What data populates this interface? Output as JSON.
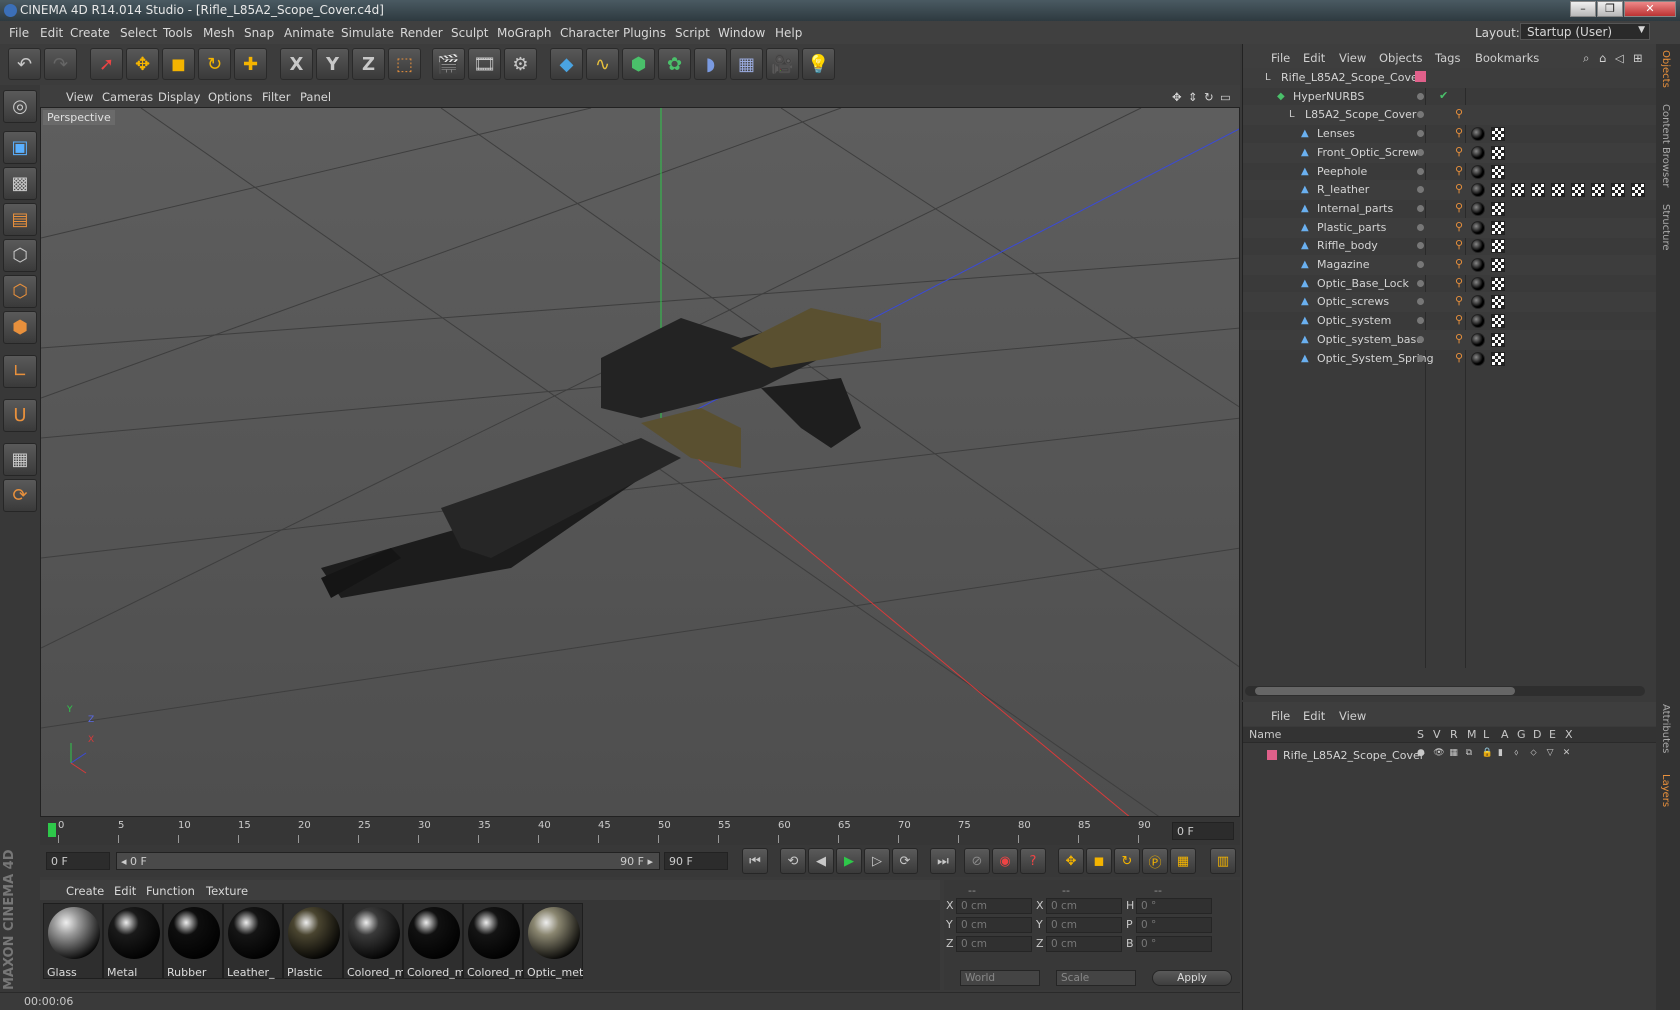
{
  "window": {
    "title": "CINEMA 4D R14.014 Studio - [Rifle_L85A2_Scope_Cover.c4d]",
    "controls": [
      "–",
      "❐",
      "✕"
    ]
  },
  "menu": [
    "File",
    "Edit",
    "Create",
    "Select",
    "Tools",
    "Mesh",
    "Snap",
    "Animate",
    "Simulate",
    "Render",
    "Sculpt",
    "MoGraph",
    "Character",
    "Plugins",
    "Script",
    "Window",
    "Help"
  ],
  "layout": {
    "label": "Layout:",
    "value": "Startup (User)"
  },
  "toolbar_icons": [
    "undo-icon",
    "redo-icon",
    "select-icon",
    "move-icon",
    "scale-icon",
    "rotate-icon",
    "live-select-icon",
    "x-axis-icon",
    "y-axis-icon",
    "z-axis-icon",
    "coordinate-system-icon",
    "render-view-icon",
    "render-picture-viewer-icon",
    "render-settings-icon",
    "cube-icon",
    "spline-icon",
    "nurbs-icon",
    "array-icon",
    "deformer-icon",
    "floor-icon",
    "camera-icon",
    "light-icon"
  ],
  "toolbar_glyphs": {
    "x": "X",
    "y": "Y",
    "z": "Z"
  },
  "viewport": {
    "menu": [
      "View",
      "Cameras",
      "Display",
      "Options",
      "Filter",
      "Panel"
    ],
    "label": "Perspective",
    "axis_labels": {
      "y": "Y",
      "z": "Z",
      "x": "X"
    }
  },
  "timeline": {
    "ticks": [
      "0",
      "5",
      "10",
      "15",
      "20",
      "25",
      "30",
      "35",
      "40",
      "45",
      "50",
      "55",
      "60",
      "65",
      "70",
      "75",
      "80",
      "85",
      "90"
    ],
    "current": "0 F"
  },
  "transport": {
    "start": "0 F",
    "range_start": "◂ 0 F",
    "range_end": "90 F ▸",
    "end": "90 F"
  },
  "materials": {
    "menu": [
      "Create",
      "Edit",
      "Function",
      "Texture"
    ],
    "items": [
      {
        "name": "Glass",
        "color": "#9a9a9a"
      },
      {
        "name": "Metal",
        "color": "#1a1a1a"
      },
      {
        "name": "Rubber",
        "color": "#0e0e0e"
      },
      {
        "name": "Leather_",
        "color": "#151515"
      },
      {
        "name": "Plastic",
        "color": "#4a4530"
      },
      {
        "name": "Colored_m",
        "color": "#3a3a3a"
      },
      {
        "name": "Colored_m",
        "color": "#111111"
      },
      {
        "name": "Colored_m",
        "color": "#141414"
      },
      {
        "name": "Optic_meta",
        "color": "#8a8670"
      }
    ],
    "brand": "MAXON CINEMA 4D"
  },
  "coords": {
    "headers": [
      "--",
      "--",
      "--"
    ],
    "rows": [
      {
        "a": "X",
        "av": "0 cm",
        "b": "X",
        "bv": "0 cm",
        "c": "H",
        "cv": "0 °"
      },
      {
        "a": "Y",
        "av": "0 cm",
        "b": "Y",
        "bv": "0 cm",
        "c": "P",
        "cv": "0 °"
      },
      {
        "a": "Z",
        "av": "0 cm",
        "b": "Z",
        "bv": "0 cm",
        "c": "B",
        "cv": "0 °"
      }
    ],
    "world": "World",
    "scale": "Scale",
    "apply": "Apply"
  },
  "status": "00:00:06",
  "objects": {
    "menu": [
      "File",
      "Edit",
      "View",
      "Objects",
      "Tags",
      "Bookmarks"
    ],
    "tree": [
      {
        "name": "Rifle_L85A2_Scope_Cover",
        "depth": 0,
        "kind": "null"
      },
      {
        "name": "HyperNURBS",
        "depth": 1,
        "kind": "nurbs"
      },
      {
        "name": "L85A2_Scope_Cover",
        "depth": 2,
        "kind": "null"
      },
      {
        "name": "Lenses",
        "depth": 3,
        "kind": "poly"
      },
      {
        "name": "Front_Optic_Screw",
        "depth": 3,
        "kind": "poly"
      },
      {
        "name": "Peephole",
        "depth": 3,
        "kind": "poly"
      },
      {
        "name": "R_leather",
        "depth": 3,
        "kind": "poly"
      },
      {
        "name": "Internal_parts",
        "depth": 3,
        "kind": "poly"
      },
      {
        "name": "Plastic_parts",
        "depth": 3,
        "kind": "poly"
      },
      {
        "name": "Riffle_body",
        "depth": 3,
        "kind": "poly"
      },
      {
        "name": "Magazine",
        "depth": 3,
        "kind": "poly"
      },
      {
        "name": "Optic_Base_Lock",
        "depth": 3,
        "kind": "poly"
      },
      {
        "name": "Optic_screws",
        "depth": 3,
        "kind": "poly"
      },
      {
        "name": "Optic_system",
        "depth": 3,
        "kind": "poly"
      },
      {
        "name": "Optic_system_base",
        "depth": 3,
        "kind": "poly"
      },
      {
        "name": "Optic_System_Spring",
        "depth": 3,
        "kind": "poly"
      }
    ]
  },
  "layers": {
    "menu": [
      "File",
      "Edit",
      "View"
    ],
    "columns": [
      "Name",
      "S",
      "V",
      "R",
      "M",
      "L",
      "A",
      "G",
      "D",
      "E",
      "X"
    ],
    "rows": [
      {
        "name": "Rifle_L85A2_Scope_Cover",
        "color": "#e0608a"
      }
    ]
  },
  "side_tabs": [
    "Objects",
    "Content Browser",
    "Structure",
    "Attributes",
    "Layers"
  ]
}
